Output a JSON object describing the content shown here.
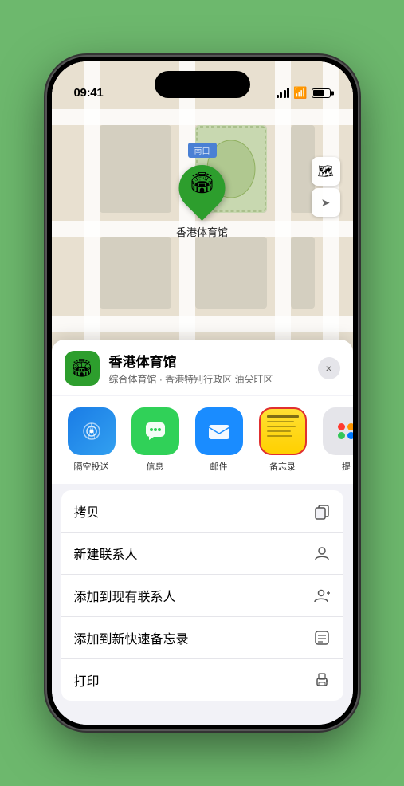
{
  "status_bar": {
    "time": "09:41",
    "location_icon": "▶"
  },
  "map": {
    "entrance_label": "南口",
    "entrance_prefix": "南",
    "place_name_map": "香港体育馆",
    "pin_emoji": "🏟"
  },
  "place_info": {
    "name": "香港体育馆",
    "description": "综合体育馆 · 香港特别行政区 油尖旺区",
    "logo_emoji": "🏟"
  },
  "share_items": [
    {
      "label": "隔空投送",
      "type": "airdrop"
    },
    {
      "label": "信息",
      "type": "messages"
    },
    {
      "label": "邮件",
      "type": "mail"
    },
    {
      "label": "备忘录",
      "type": "notes"
    },
    {
      "label": "提",
      "type": "more"
    }
  ],
  "actions": [
    {
      "label": "拷贝",
      "icon": "copy"
    },
    {
      "label": "新建联系人",
      "icon": "person"
    },
    {
      "label": "添加到现有联系人",
      "icon": "person-add"
    },
    {
      "label": "添加到新快速备忘录",
      "icon": "note"
    },
    {
      "label": "打印",
      "icon": "print"
    }
  ],
  "close_btn": "×"
}
